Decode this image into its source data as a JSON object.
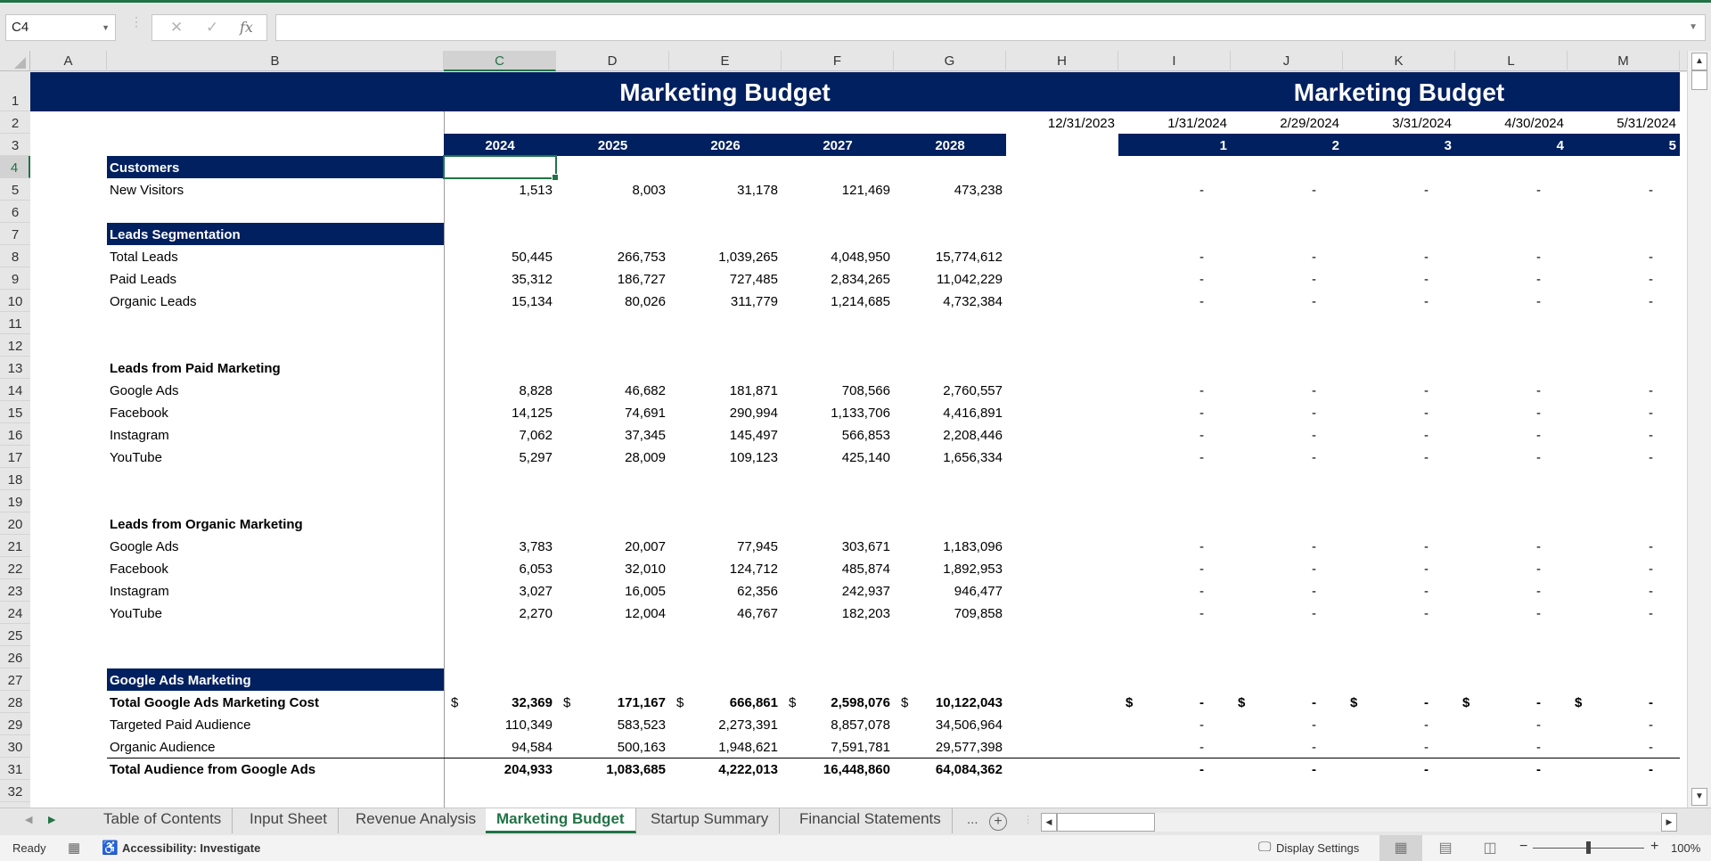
{
  "formula_bar": {
    "name_box": "C4",
    "cancel_icon": "✕",
    "enter_icon": "✓",
    "fx_label": "fx",
    "formula_value": ""
  },
  "columns": [
    "A",
    "B",
    "C",
    "D",
    "E",
    "F",
    "G",
    "H",
    "I",
    "J",
    "K",
    "L",
    "M"
  ],
  "active_column": "C",
  "rows": [
    "1",
    "2",
    "3",
    "4",
    "5",
    "6",
    "7",
    "8",
    "9",
    "10",
    "11",
    "12",
    "13",
    "14",
    "15",
    "16",
    "17",
    "18",
    "19",
    "20",
    "21",
    "22",
    "23",
    "24",
    "25",
    "26",
    "27",
    "28",
    "29",
    "30",
    "31",
    "32"
  ],
  "active_row": "4",
  "sheet": {
    "annual_title": "Marketing Budget",
    "monthly_title": "Marketing Budget",
    "years": [
      "2024",
      "2025",
      "2026",
      "2027",
      "2028"
    ],
    "month_dates": [
      "12/31/2023",
      "1/31/2024",
      "2/29/2024",
      "3/31/2024",
      "4/30/2024",
      "5/31/2024"
    ],
    "month_numbers": [
      "1",
      "2",
      "3",
      "4",
      "5"
    ],
    "dash": "-",
    "currency": "$",
    "sections": {
      "customers": "Customers",
      "leads_segmentation": "Leads Segmentation",
      "leads_paid": "Leads from Paid Marketing",
      "leads_organic": "Leads from Organic Marketing",
      "google_ads": "Google Ads Marketing"
    },
    "lines": {
      "new_visitors": {
        "label": "New Visitors",
        "values": [
          "1,513",
          "8,003",
          "31,178",
          "121,469",
          "473,238"
        ]
      },
      "total_leads": {
        "label": "Total Leads",
        "values": [
          "50,445",
          "266,753",
          "1,039,265",
          "4,048,950",
          "15,774,612"
        ]
      },
      "paid_leads": {
        "label": "Paid Leads",
        "values": [
          "35,312",
          "186,727",
          "727,485",
          "2,834,265",
          "11,042,229"
        ]
      },
      "organic_leads": {
        "label": "Organic Leads",
        "values": [
          "15,134",
          "80,026",
          "311,779",
          "1,214,685",
          "4,732,384"
        ]
      },
      "paid_google": {
        "label": "Google Ads",
        "values": [
          "8,828",
          "46,682",
          "181,871",
          "708,566",
          "2,760,557"
        ]
      },
      "paid_facebook": {
        "label": "Facebook",
        "values": [
          "14,125",
          "74,691",
          "290,994",
          "1,133,706",
          "4,416,891"
        ]
      },
      "paid_instagram": {
        "label": "Instagram",
        "values": [
          "7,062",
          "37,345",
          "145,497",
          "566,853",
          "2,208,446"
        ]
      },
      "paid_youtube": {
        "label": "YouTube",
        "values": [
          "5,297",
          "28,009",
          "109,123",
          "425,140",
          "1,656,334"
        ]
      },
      "org_google": {
        "label": "Google Ads",
        "values": [
          "3,783",
          "20,007",
          "77,945",
          "303,671",
          "1,183,096"
        ]
      },
      "org_facebook": {
        "label": "Facebook",
        "values": [
          "6,053",
          "32,010",
          "124,712",
          "485,874",
          "1,892,953"
        ]
      },
      "org_instagram": {
        "label": "Instagram",
        "values": [
          "3,027",
          "16,005",
          "62,356",
          "242,937",
          "946,477"
        ]
      },
      "org_youtube": {
        "label": "YouTube",
        "values": [
          "2,270",
          "12,004",
          "46,767",
          "182,203",
          "709,858"
        ]
      },
      "gads_cost": {
        "label": "Total Google Ads Marketing Cost",
        "values": [
          "32,369",
          "171,167",
          "666,861",
          "2,598,076",
          "10,122,043"
        ]
      },
      "gads_paid_aud": {
        "label": "Targeted Paid Audience",
        "values": [
          "110,349",
          "583,523",
          "2,273,391",
          "8,857,078",
          "34,506,964"
        ]
      },
      "gads_org_aud": {
        "label": "Organic Audience",
        "values": [
          "94,584",
          "500,163",
          "1,948,621",
          "7,591,781",
          "29,577,398"
        ]
      },
      "gads_total_aud": {
        "label": "Total Audience from Google Ads",
        "values": [
          "204,933",
          "1,083,685",
          "4,222,013",
          "16,448,860",
          "64,084,362"
        ]
      }
    }
  },
  "sheet_tabs": {
    "tabs": [
      "Table of Contents",
      "Input Sheet",
      "Revenue Analysis",
      "Marketing Budget",
      "Startup Summary",
      "Financial Statements"
    ],
    "active": "Marketing Budget",
    "more": "...",
    "add": "+"
  },
  "status_bar": {
    "ready": "Ready",
    "accessibility": "Accessibility: Investigate",
    "display_settings": "Display Settings",
    "zoom_minus": "−",
    "zoom_plus": "+",
    "zoom_level": "100%"
  },
  "colors": {
    "header_navy": "#002060",
    "excel_green": "#217346"
  }
}
